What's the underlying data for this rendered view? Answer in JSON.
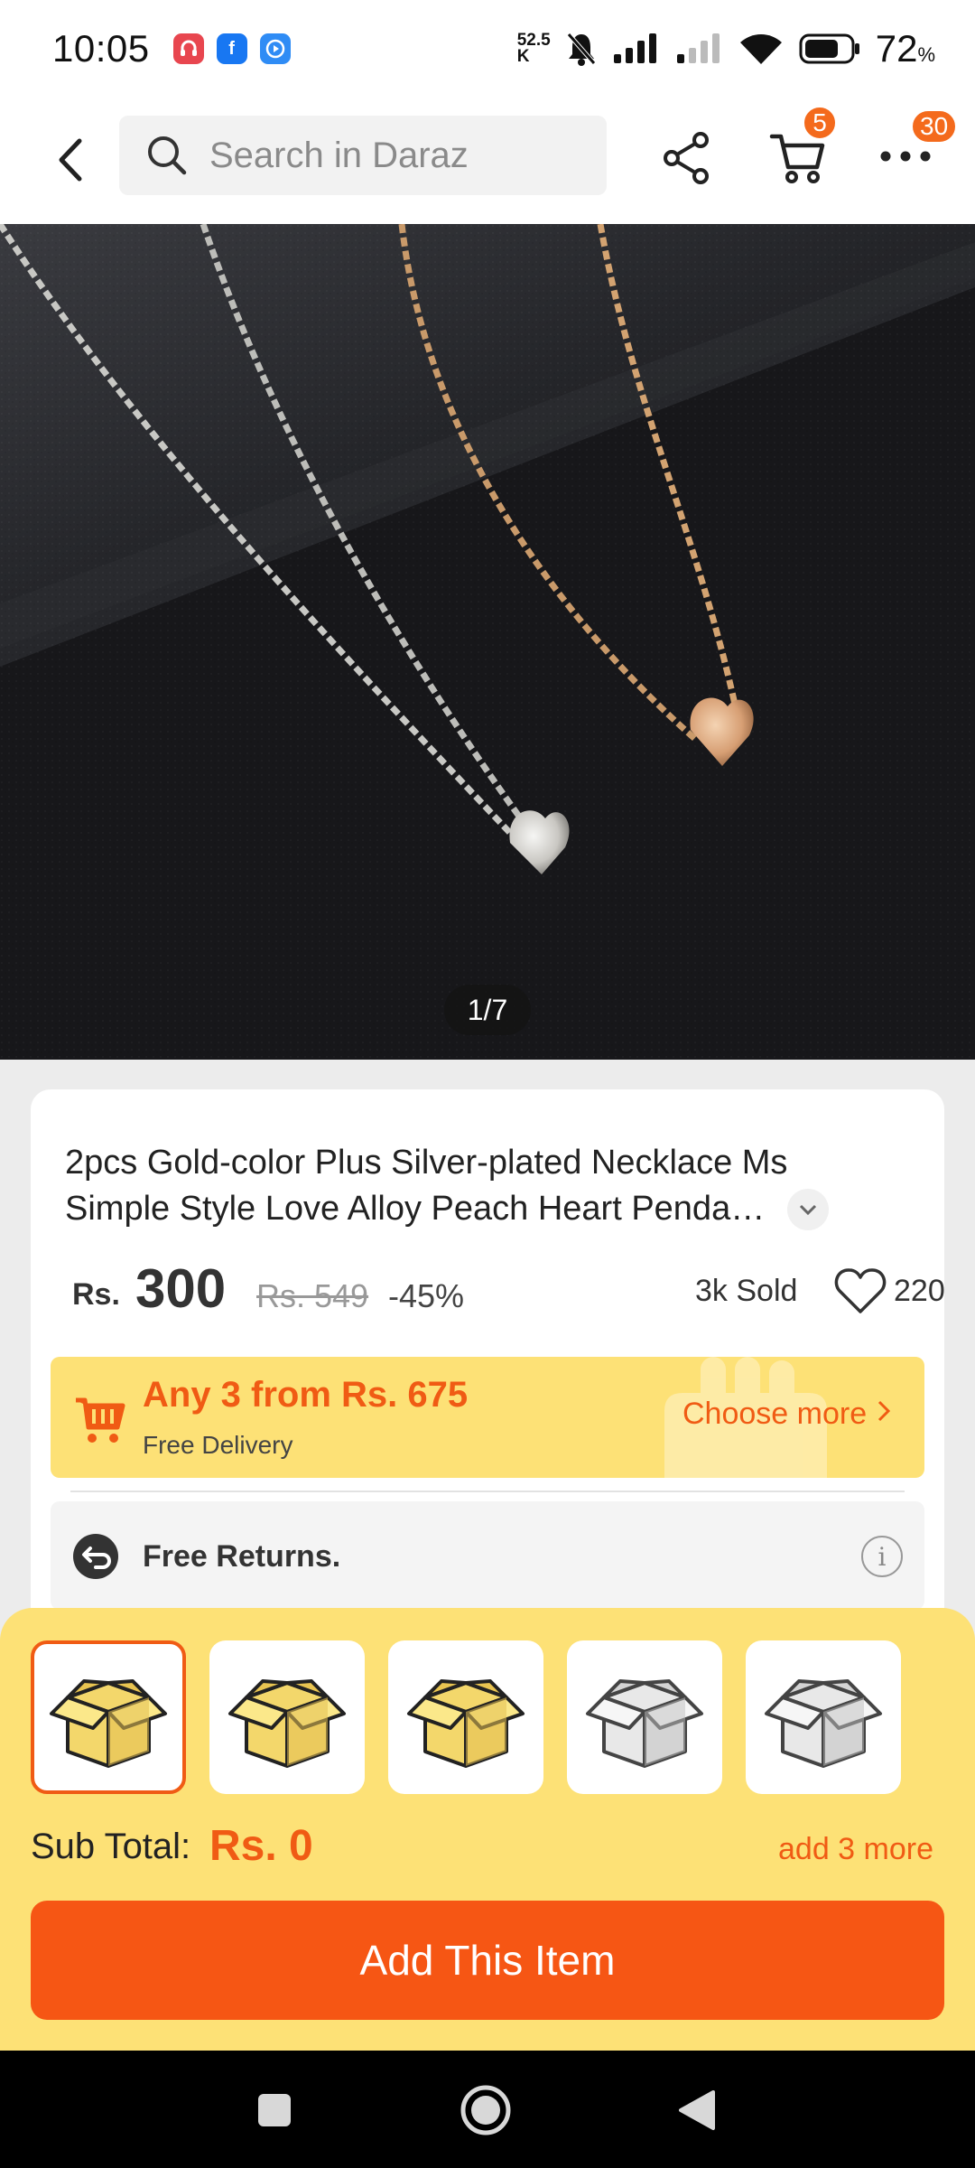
{
  "status_bar": {
    "time": "10:05",
    "net_speed_top": "52.5",
    "net_speed_bottom": "K",
    "battery": "72",
    "battery_unit": "%"
  },
  "header": {
    "search_placeholder": "Search in Daraz",
    "cart_badge": "5",
    "more_badge": "30"
  },
  "gallery": {
    "counter": "1/7"
  },
  "product": {
    "title": "2pcs Gold-color Plus Silver-plated Necklace Ms Simple Style Love Alloy Peach Heart Penda…",
    "currency": "Rs.",
    "price": "300",
    "old_price": "Rs. 549",
    "discount": "-45%",
    "sold": "3k Sold",
    "wishlist_count": "220"
  },
  "promo": {
    "title": "Any 3 from Rs. 675",
    "subtitle": "Free Delivery",
    "link": "Choose more"
  },
  "returns": {
    "label": "Free Returns."
  },
  "bundle": {
    "slots": [
      {
        "state": "filled"
      },
      {
        "state": "filled"
      },
      {
        "state": "filled"
      },
      {
        "state": "empty"
      },
      {
        "state": "empty"
      }
    ],
    "subtotal_label": "Sub Total:",
    "subtotal_value": "Rs. 0",
    "add_more": "add 3 more",
    "button_label": "Add This Item"
  },
  "colors": {
    "accent": "#f05b14",
    "sheet_bg": "#fde176",
    "button_bg": "#f65614"
  }
}
